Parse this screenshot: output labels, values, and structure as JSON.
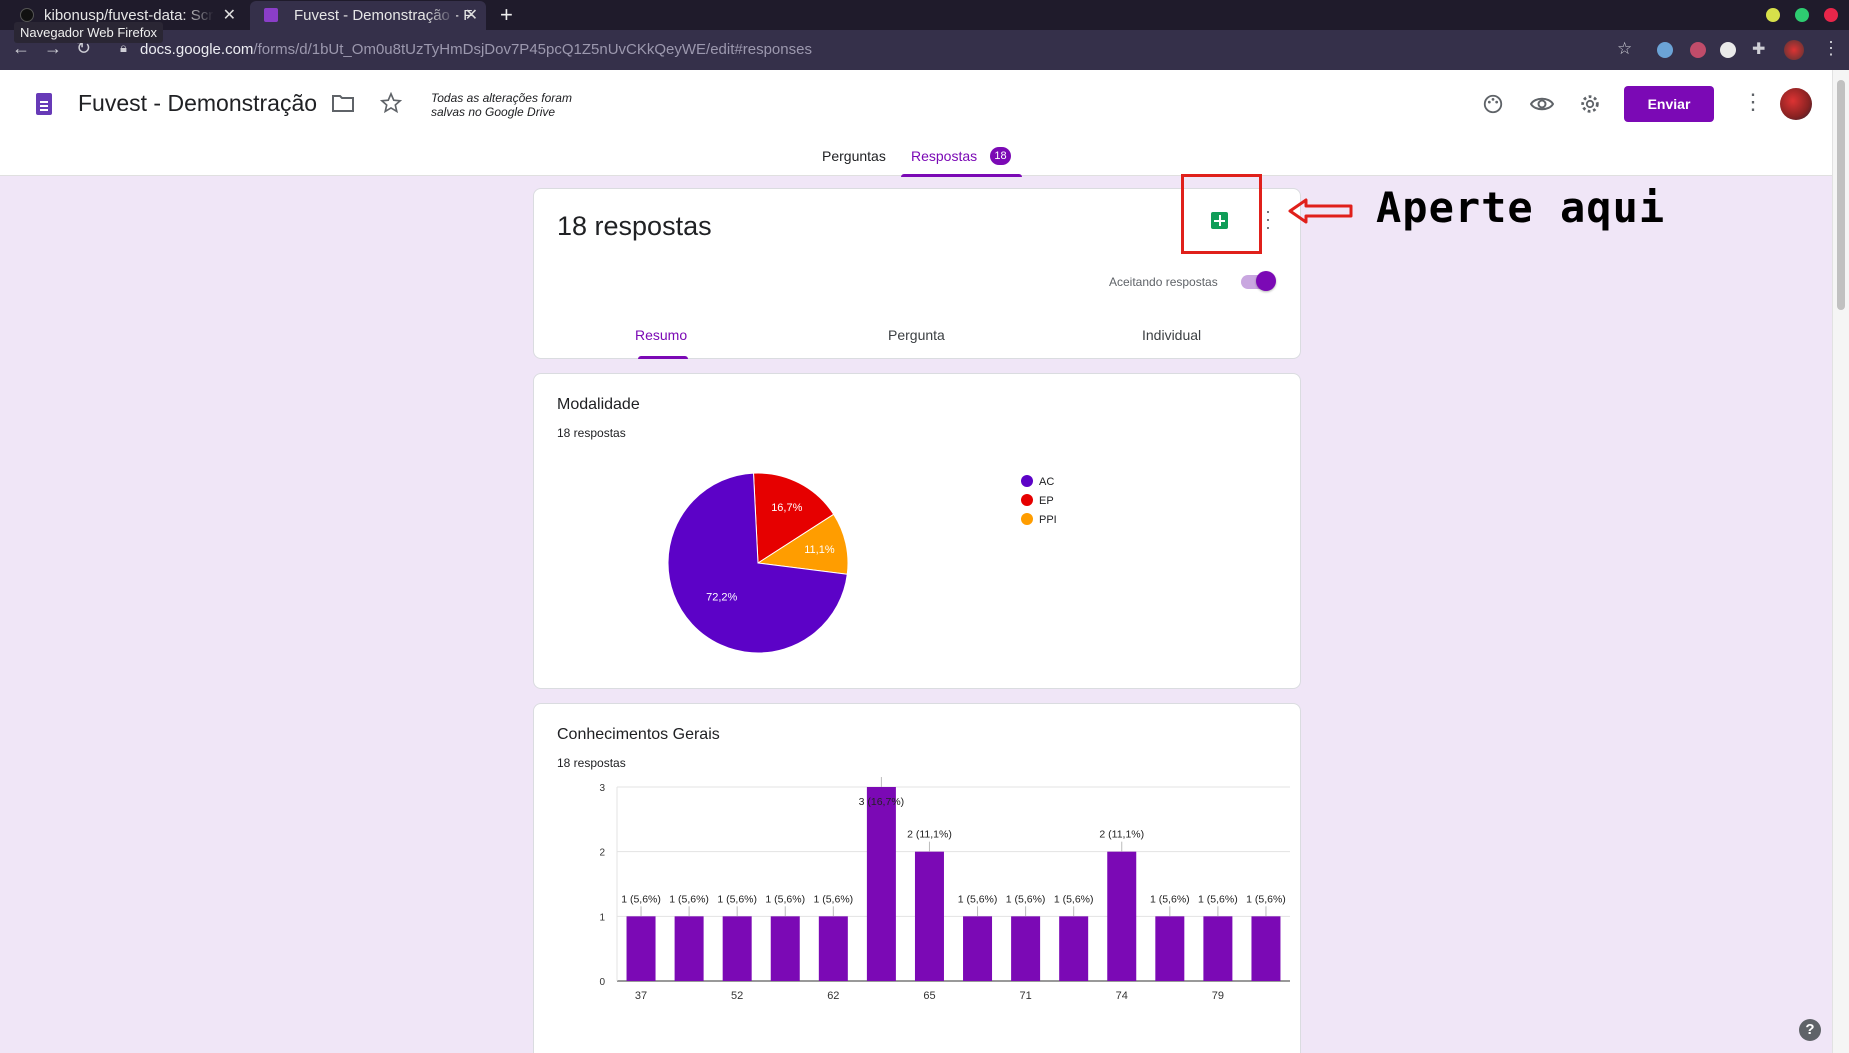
{
  "browser": {
    "tabs": [
      {
        "title": "kibonusp/fuvest-data: Scr"
      },
      {
        "title": "Fuvest - Demonstração - F"
      }
    ],
    "new_tab_symbol": "+",
    "tooltip": "Navegador Web Firefox",
    "url_domain": "docs.google.com",
    "url_path": "/forms/d/1bUt_Om0u8tUzTyHmDsjDov7P45pcQ1Z5nUvCKkQeyWE/edit#responses",
    "window_buttons": [
      "#d7e04a",
      "#2ecc71",
      "#e8264a"
    ]
  },
  "header": {
    "form_title": "Fuvest - Demonstração",
    "saved_status": "Todas as alterações foram salvas no Google Drive",
    "send_label": "Enviar",
    "tabs": {
      "questions": "Perguntas",
      "responses": "Respostas",
      "responses_count": "18"
    },
    "accent_color": "#7b09b5"
  },
  "summary_card": {
    "title": "18 respostas",
    "accepting_label": "Aceitando respostas",
    "accepting": true,
    "subtabs": [
      "Resumo",
      "Pergunta",
      "Individual"
    ],
    "active_subtab": "Resumo"
  },
  "annotation": {
    "text": "Aperte aqui",
    "color": "#e0201b"
  },
  "questions": [
    {
      "title": "Modalidade",
      "count": "18 respostas"
    },
    {
      "title": "Conhecimentos Gerais",
      "count": "18 respostas"
    }
  ],
  "chart_data": [
    {
      "type": "pie",
      "categories": [
        "AC",
        "EP",
        "PPI"
      ],
      "values": [
        72.2,
        16.7,
        11.1
      ],
      "labels": [
        "72,2%",
        "16,7%",
        "11,1%"
      ],
      "colors": [
        "#5c02c7",
        "#e60000",
        "#ff9d00"
      ],
      "legend_position": "right"
    },
    {
      "type": "bar",
      "categories": [
        "37",
        "",
        "52",
        "",
        "62",
        "",
        "65",
        "",
        "71",
        "",
        "74",
        "",
        "79",
        ""
      ],
      "values": [
        1,
        1,
        1,
        1,
        1,
        3,
        2,
        1,
        1,
        1,
        2,
        1,
        1,
        1
      ],
      "labels": [
        "1 (5,6%)",
        "1 (5,6%)",
        "1 (5,6%)",
        "1 (5,6%)",
        "1 (5,6%)",
        "3 (16,7%)",
        "2 (11,1%)",
        "1 (5,6%)",
        "1 (5,6%)",
        "1 (5,6%)",
        "2 (11,1%)",
        "1 (5,6%)",
        "1 (5,6%)",
        "1 (5,6%)"
      ],
      "y_ticks": [
        "0",
        "1",
        "2",
        "3"
      ],
      "ylim": [
        0,
        3
      ],
      "color": "#7b09b5",
      "grid": true
    }
  ]
}
